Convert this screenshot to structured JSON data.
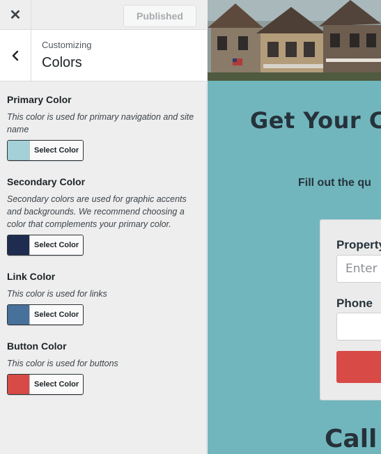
{
  "topbar": {
    "close_glyph": "✕",
    "publish_label": "Published"
  },
  "section": {
    "breadcrumb": "Customizing",
    "title": "Colors"
  },
  "controls": [
    {
      "title": "Primary Color",
      "description": "This color is used for primary navigation and site name",
      "button_label": "Select Color",
      "color": "#a4d0d7"
    },
    {
      "title": "Secondary Color",
      "description": "Secondary colors are used for graphic accents and backgrounds. We recommend choosing a color that complements your primary color.",
      "button_label": "Select Color",
      "color": "#1e2c4f"
    },
    {
      "title": "Link Color",
      "description": "This color is used for links",
      "button_label": "Select Color",
      "color": "#47709a"
    },
    {
      "title": "Button Color",
      "description": "This color is used for buttons",
      "button_label": "Select Color",
      "color": "#d84a46"
    }
  ],
  "preview": {
    "headline": "Get Your Ca",
    "subtext": "Fill out the qu",
    "form": {
      "property_label": "Property",
      "property_placeholder": "Enter Y",
      "phone_label": "Phone",
      "phone_value": ""
    },
    "call_heading": "Call",
    "background_color": "#72b6bd",
    "button_color": "#d84a46"
  }
}
